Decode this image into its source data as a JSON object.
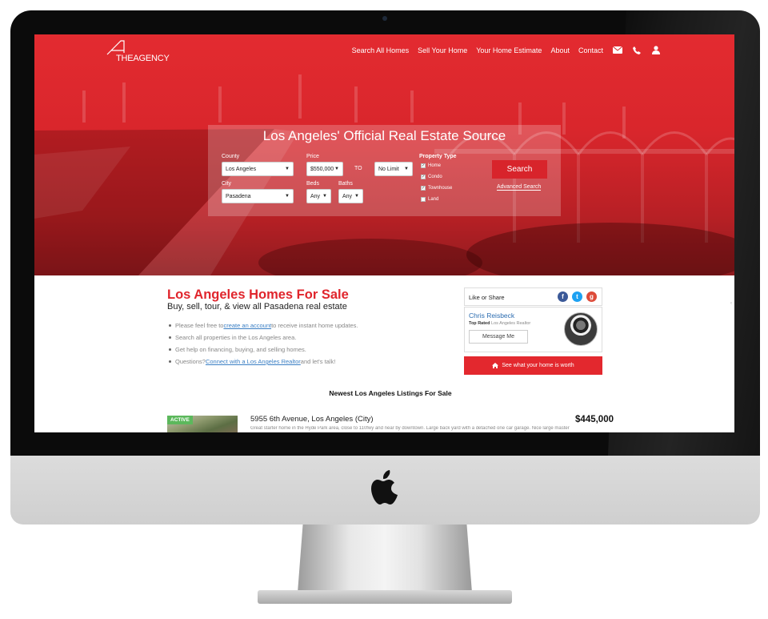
{
  "brand": {
    "name": "THEAGENCY"
  },
  "nav": {
    "items": [
      "Search All Homes",
      "Sell Your Home",
      "Your Home Estimate",
      "About",
      "Contact"
    ],
    "icons": [
      "envelope-icon",
      "phone-icon",
      "user-icon"
    ]
  },
  "search": {
    "title": "Los Angeles' Official Real Estate Source",
    "county_label": "County",
    "county_value": "Los Angeles",
    "city_label": "City",
    "city_value": "Pasadena",
    "price_label": "Price",
    "price_min": "$550,000",
    "price_to": "TO",
    "price_max": "No Limit",
    "beds_label": "Beds",
    "beds_value": "Any",
    "baths_label": "Baths",
    "baths_value": "Any",
    "property_type_label": "Property Type",
    "property_types": [
      {
        "label": "Home",
        "checked": true
      },
      {
        "label": "Condo",
        "checked": true
      },
      {
        "label": "Townhouse",
        "checked": true
      },
      {
        "label": "Land",
        "checked": false
      }
    ],
    "button": "Search",
    "advanced": "Advanced Search"
  },
  "main": {
    "heading": "Los Angeles Homes For Sale",
    "subheading": "Buy, sell, tour, & view all Pasadena real estate",
    "bullets": [
      {
        "pre": "Please feel free to ",
        "link": "create an account",
        "post": " to receive instant home updates."
      },
      {
        "pre": "Search all properties in the Los Angeles area.",
        "link": "",
        "post": ""
      },
      {
        "pre": "Get help on financing, buying, and selling homes.",
        "link": "",
        "post": ""
      },
      {
        "pre": "Questions? ",
        "link": "Connect with a Los Angeles Realtor",
        "post": " and let's talk!"
      }
    ]
  },
  "sidebar": {
    "share_label": "Like or Share",
    "social": [
      {
        "icon": "facebook-icon",
        "glyph": "f",
        "color": "#3b5998"
      },
      {
        "icon": "twitter-icon",
        "glyph": "t",
        "color": "#1da1f2"
      },
      {
        "icon": "google-plus-icon",
        "glyph": "g",
        "color": "#dd4b39"
      }
    ],
    "agent_name": "Chris Reisbeck",
    "agent_rating": "Top Rated",
    "agent_title": "Los Angeles Realtor",
    "message_button": "Message Me",
    "worth_button": "See what your home is worth"
  },
  "listings": {
    "title": "Newest Los Angeles Listings For Sale",
    "items": [
      {
        "badge": "ACTIVE",
        "address": "5955 6th Avenue, Los Angeles (City)",
        "price": "$445,000",
        "description": "Great starter home in the Hyde Park area, close to 110fwy and near by downtown. Large back yard with a detached one car garage. Nice large master"
      }
    ]
  },
  "colors": {
    "brand_red": "#e0252c",
    "link_blue": "#3b7fc4",
    "active_green": "#5cb85c"
  }
}
